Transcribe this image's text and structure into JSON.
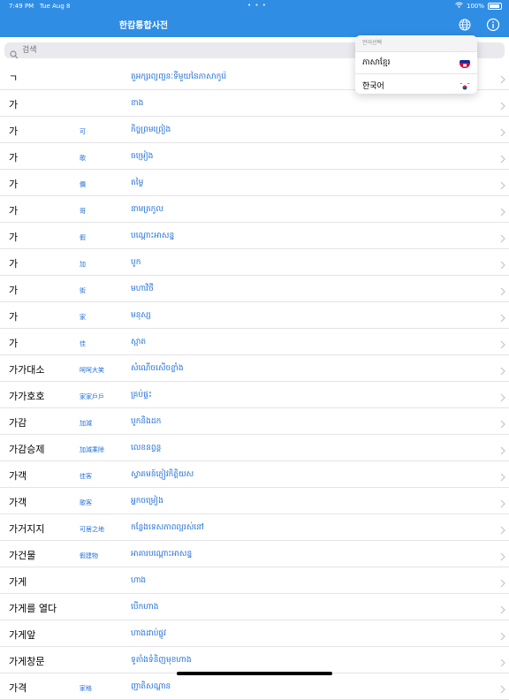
{
  "status": {
    "time": "7:49 PM",
    "date": "Tue Aug 8",
    "dots": "• • •",
    "battery": "100%"
  },
  "header": {
    "title": "한캄통합사전"
  },
  "search": {
    "placeholder": "검색"
  },
  "dropdown": {
    "header": "언어선택",
    "items": [
      {
        "label": "ភាសាខ្មែរ",
        "flag": "cambodia"
      },
      {
        "label": "한국어",
        "flag": "korea"
      }
    ]
  },
  "rows": [
    {
      "word": "ㄱ",
      "hanja": "",
      "meaning": "តួអក្សរព្យញ្ជនៈទីមួយនៃភាសាកូរ៉េ"
    },
    {
      "word": "가",
      "hanja": "",
      "meaning": "ខាង"
    },
    {
      "word": "가",
      "hanja": "可",
      "meaning": "កិច្ចព្រមព្រៀង"
    },
    {
      "word": "가",
      "hanja": "歌",
      "meaning": "ចម្រៀង"
    },
    {
      "word": "가",
      "hanja": "價",
      "meaning": "តម្លៃ"
    },
    {
      "word": "가",
      "hanja": "哥",
      "meaning": "នាមត្រកូល"
    },
    {
      "word": "가",
      "hanja": "假",
      "meaning": "បណ្តោះអាសន្ន"
    },
    {
      "word": "가",
      "hanja": "加",
      "meaning": "បូក"
    },
    {
      "word": "가",
      "hanja": "街",
      "meaning": "មហាវិថី"
    },
    {
      "word": "가",
      "hanja": "家",
      "meaning": "មនុស្ស"
    },
    {
      "word": "가",
      "hanja": "佳",
      "meaning": "ស្អាត"
    },
    {
      "word": "가가대소",
      "hanja": "呵呵大笑",
      "meaning": "សំណើចសើចខ្លាំង"
    },
    {
      "word": "가가호호",
      "hanja": "家家戶戶",
      "meaning": "គ្រប់ផ្ទះ"
    },
    {
      "word": "가감",
      "hanja": "加減",
      "meaning": "បូកនិងដក"
    },
    {
      "word": "가감승제",
      "hanja": "加減乘除",
      "meaning": "លេខនព្វន្ត"
    },
    {
      "word": "가객",
      "hanja": "佳客",
      "meaning": "ស្វាគមន៍ភ្ញៀវកិត្តិយស"
    },
    {
      "word": "가객",
      "hanja": "歌客",
      "meaning": "អ្នកចម្រៀង"
    },
    {
      "word": "가거지지",
      "hanja": "可居之地",
      "meaning": "កន្លែងទេសភាពល្អរស់នៅ"
    },
    {
      "word": "가건물",
      "hanja": "假建物",
      "meaning": "អាគារបណ្តោះអាសន្ន"
    },
    {
      "word": "가게",
      "hanja": "",
      "meaning": "ហាង"
    },
    {
      "word": "가게를 열다",
      "hanja": "",
      "meaning": "បើកហាង"
    },
    {
      "word": "가게앞",
      "hanja": "",
      "meaning": "ហាងដាប់ផ្លូវ"
    },
    {
      "word": "가게창문",
      "hanja": "",
      "meaning": "ទូតាំងទំនិញមុខហាង"
    },
    {
      "word": "가격",
      "hanja": "家格",
      "meaning": "ញាតិសណ្តាន"
    }
  ]
}
